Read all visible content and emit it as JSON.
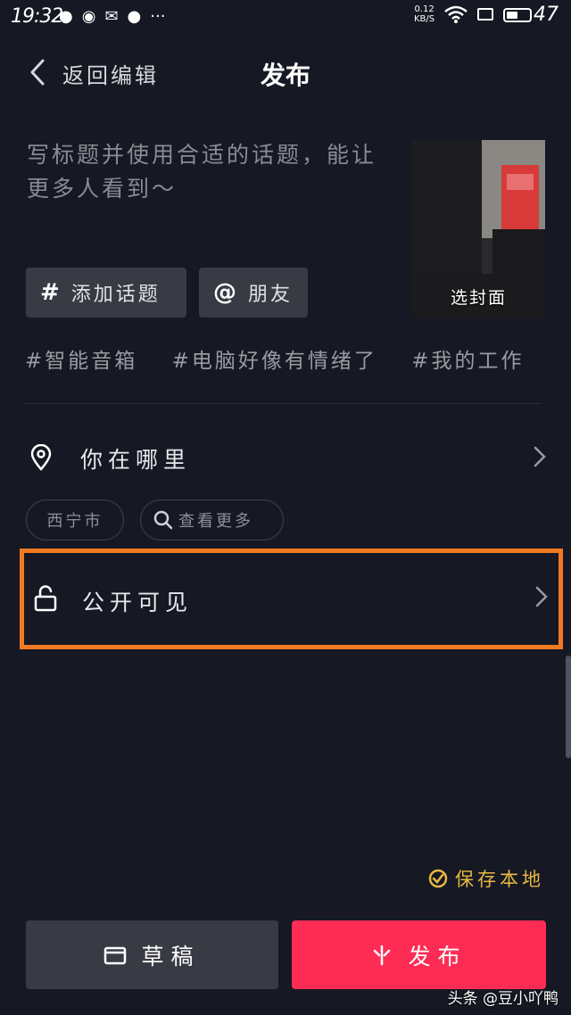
{
  "status_bar": {
    "time": "19:32",
    "net_speed_value": "0.12",
    "net_speed_unit": "KB/S",
    "battery": "47"
  },
  "header": {
    "back_label": "返回编辑",
    "title": "发布"
  },
  "caption": {
    "placeholder": "写标题并使用合适的话题，能让更多人看到～"
  },
  "cover": {
    "label": "选封面"
  },
  "chips": {
    "topic_symbol": "#",
    "topic_label": "添加话题",
    "friend_symbol": "@",
    "friend_label": "朋友"
  },
  "suggested_tags": [
    "#智能音箱",
    "#电脑好像有情绪了",
    "#我的工作"
  ],
  "location": {
    "label": "你在哪里",
    "city": "西宁市",
    "more": "查看更多"
  },
  "privacy": {
    "label": "公开可见",
    "highlight_color": "#f07a22"
  },
  "footer": {
    "save_local": "保存本地",
    "draft_label": "草稿",
    "publish_label": "发布",
    "publish_color": "#fe2c55",
    "accent_yellow": "#e9b840"
  },
  "watermark": "头条 @豆小吖鸭",
  "icons": [
    "back-chevron-icon",
    "location-pin-icon",
    "search-icon",
    "unlock-icon",
    "chevron-right-icon",
    "check-circle-icon",
    "draft-box-icon",
    "publish-spark-icon",
    "wifi-icon",
    "battery-icon"
  ]
}
